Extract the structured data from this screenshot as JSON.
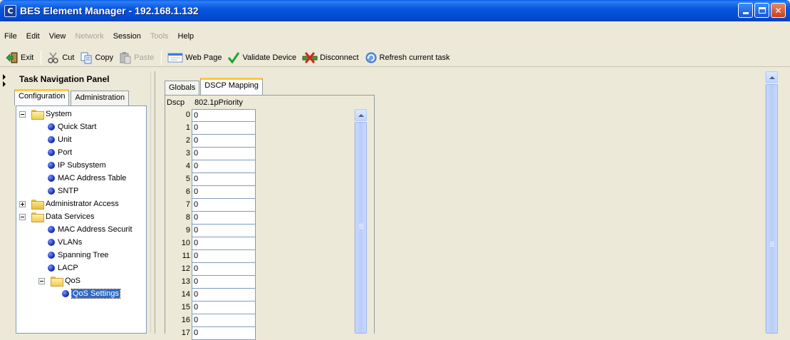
{
  "window": {
    "title": "BES Element Manager - 192.168.1.132",
    "icon_glyph": "C"
  },
  "menu": [
    {
      "label": "File",
      "enabled": true
    },
    {
      "label": "Edit",
      "enabled": true
    },
    {
      "label": "View",
      "enabled": true
    },
    {
      "label": "Network",
      "enabled": false
    },
    {
      "label": "Session",
      "enabled": true
    },
    {
      "label": "Tools",
      "enabled": false
    },
    {
      "label": "Help",
      "enabled": true
    }
  ],
  "toolbar": {
    "exit": "Exit",
    "cut": "Cut",
    "copy": "Copy",
    "paste": "Paste",
    "web_page": "Web Page",
    "validate": "Validate Device",
    "disconnect": "Disconnect",
    "refresh": "Refresh current task"
  },
  "nav": {
    "title": "Task Navigation Panel",
    "tabs": [
      "Configuration",
      "Administration"
    ],
    "active_tab": "Configuration",
    "tree": [
      {
        "label": "System",
        "type": "folder",
        "expanded": true,
        "level": 0
      },
      {
        "label": "Quick Start",
        "type": "leaf",
        "level": 1
      },
      {
        "label": "Unit",
        "type": "leaf",
        "level": 1
      },
      {
        "label": "Port",
        "type": "leaf",
        "level": 1
      },
      {
        "label": "IP Subsystem",
        "type": "leaf",
        "level": 1
      },
      {
        "label": "MAC Address Table",
        "type": "leaf",
        "level": 1
      },
      {
        "label": "SNTP",
        "type": "leaf",
        "level": 1
      },
      {
        "label": "Administrator Access",
        "type": "folder",
        "expanded": false,
        "level": 0
      },
      {
        "label": "Data Services",
        "type": "folder",
        "expanded": true,
        "level": 0
      },
      {
        "label": "MAC Address Securit",
        "type": "leaf",
        "level": 1
      },
      {
        "label": "VLANs",
        "type": "leaf",
        "level": 1
      },
      {
        "label": "Spanning Tree",
        "type": "leaf",
        "level": 1
      },
      {
        "label": "LACP",
        "type": "leaf",
        "level": 1
      },
      {
        "label": "QoS",
        "type": "folder",
        "expanded": true,
        "level": 1
      },
      {
        "label": "QoS Settings",
        "type": "leaf",
        "level": 2,
        "selected": true
      }
    ]
  },
  "content": {
    "tabs": [
      "Globals",
      "DSCP Mapping"
    ],
    "active_tab": "DSCP Mapping",
    "columns": [
      "Dscp",
      "802.1pPriority"
    ],
    "rows": [
      [
        "0",
        "0"
      ],
      [
        "1",
        "0"
      ],
      [
        "2",
        "0"
      ],
      [
        "3",
        "0"
      ],
      [
        "4",
        "0"
      ],
      [
        "5",
        "0"
      ],
      [
        "6",
        "0"
      ],
      [
        "7",
        "0"
      ],
      [
        "8",
        "0"
      ],
      [
        "9",
        "0"
      ],
      [
        "10",
        "0"
      ],
      [
        "11",
        "0"
      ],
      [
        "12",
        "0"
      ],
      [
        "13",
        "0"
      ],
      [
        "14",
        "0"
      ],
      [
        "15",
        "0"
      ],
      [
        "16",
        "0"
      ],
      [
        "17",
        "0"
      ]
    ]
  }
}
